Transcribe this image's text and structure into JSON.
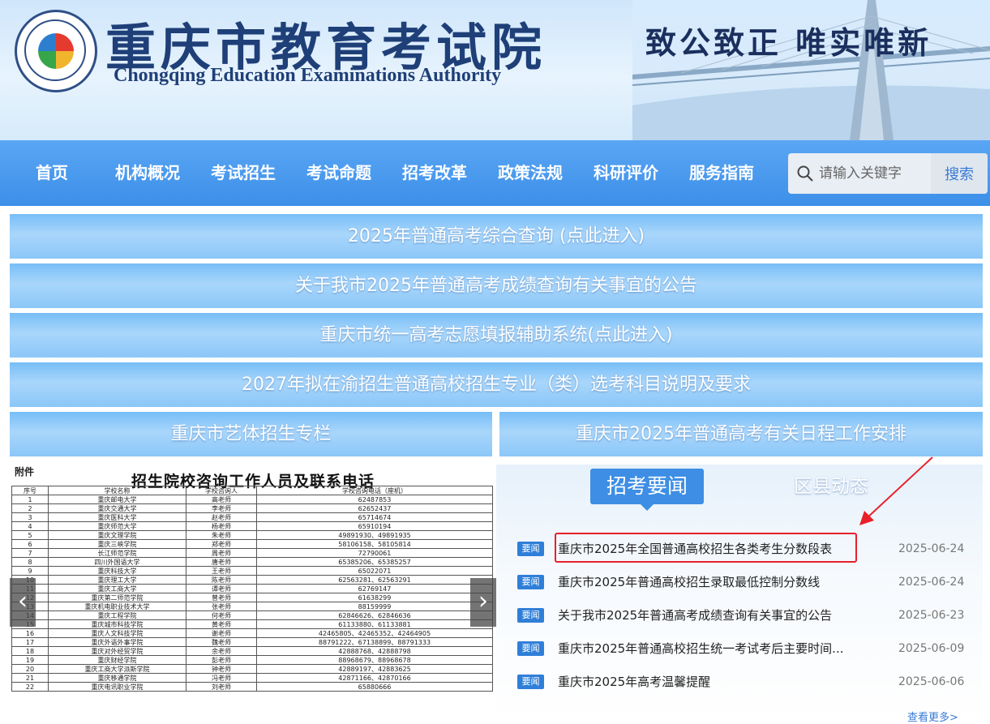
{
  "header": {
    "title": "重庆市教育考试院",
    "subtitle": "Chongqing Education Examinations Authority",
    "slogan": "致公致正  唯实唯新"
  },
  "nav": {
    "items": [
      "首页",
      "机构概况",
      "考试招生",
      "考试命题",
      "招考改革",
      "政策法规",
      "科研评价",
      "服务指南"
    ],
    "search_placeholder": "请输入关键字",
    "search_button": "搜索"
  },
  "banners": [
    "2025年普通高考综合查询 (点此进入)",
    "关于我市2025年普通高考成绩查询有关事宜的公告",
    "重庆市统一高考志愿填报辅助系统(点此进入)",
    "2027年拟在渝招生普通高校招生专业（类）选考科目说明及要求"
  ],
  "half_banners": [
    "重庆市艺体招生专栏",
    "重庆市2025年普通高考有关日程工作安排"
  ],
  "slideshow": {
    "doc_label": "附件",
    "doc_title": "招生院校咨询工作人员及联系电话",
    "headers": [
      "序号",
      "学校名称",
      "学校咨询人",
      "学校咨询电话（座机）"
    ],
    "rows": [
      [
        "1",
        "重庆邮电大学",
        "高老师",
        "62487853"
      ],
      [
        "2",
        "重庆交通大学",
        "李老师",
        "62652437"
      ],
      [
        "3",
        "重庆医科大学",
        "赵老师",
        "65714674"
      ],
      [
        "4",
        "重庆师范大学",
        "杨老师",
        "65910194"
      ],
      [
        "5",
        "重庆文理学院",
        "朱老师",
        "49891930、49891935"
      ],
      [
        "6",
        "重庆三峡学院",
        "郑老师",
        "58106158、58105814"
      ],
      [
        "7",
        "长江师范学院",
        "周老师",
        "72790061"
      ],
      [
        "8",
        "四川外国语大学",
        "唐老师",
        "65385206、65385257"
      ],
      [
        "9",
        "重庆科技大学",
        "王老师",
        "65022071"
      ],
      [
        "10",
        "重庆理工大学",
        "陈老师",
        "62563281、62563291"
      ],
      [
        "11",
        "重庆工商大学",
        "谭老师",
        "62769147"
      ],
      [
        "12",
        "重庆第二师范学院",
        "曾老师",
        "61638299"
      ],
      [
        "13",
        "重庆机电职业技术大学",
        "张老师",
        "88159999"
      ],
      [
        "14",
        "重庆工程学院",
        "何老师",
        "62846626、62846636"
      ],
      [
        "15",
        "重庆城市科技学院",
        "黄老师",
        "61133880、61133881"
      ],
      [
        "16",
        "重庆人文科技学院",
        "谢老师",
        "42465805、42465352、42464905"
      ],
      [
        "17",
        "重庆外语外事学院",
        "魏老师",
        "88791222、67138899、88791333"
      ],
      [
        "18",
        "重庆对外经贸学院",
        "余老师",
        "42888768、42888798"
      ],
      [
        "19",
        "重庆财经学院",
        "彭老师",
        "88968679、88968678"
      ],
      [
        "20",
        "重庆工商大学派斯学院",
        "钟老师",
        "42889197、42883625"
      ],
      [
        "21",
        "重庆移通学院",
        "冯老师",
        "42871166、42870166"
      ],
      [
        "22",
        "重庆电讯职业学院",
        "刘老师",
        "65880666"
      ]
    ]
  },
  "news": {
    "tab_active": "招考要闻",
    "tab_inactive": "区县动态",
    "badge": "要闻",
    "items": [
      {
        "title": "重庆市2025年全国普通高校招生各类考生分数段表",
        "date": "2025-06-24"
      },
      {
        "title": "重庆市2025年普通高校招生录取最低控制分数线",
        "date": "2025-06-24"
      },
      {
        "title": "关于我市2025年普通高考成绩查询有关事宜的公告",
        "date": "2025-06-23"
      },
      {
        "title": "重庆市2025年普通高校招生统一考试考后主要时间...",
        "date": "2025-06-09"
      },
      {
        "title": "重庆市2025年高考温馨提醒",
        "date": "2025-06-06"
      }
    ],
    "more": "查看更多>"
  },
  "colors": {
    "nav_blue": "#3c8fe8",
    "banner_blue": "#8bc7f8",
    "badge_blue": "#2f7fd8",
    "highlight_red": "#e8202a"
  }
}
